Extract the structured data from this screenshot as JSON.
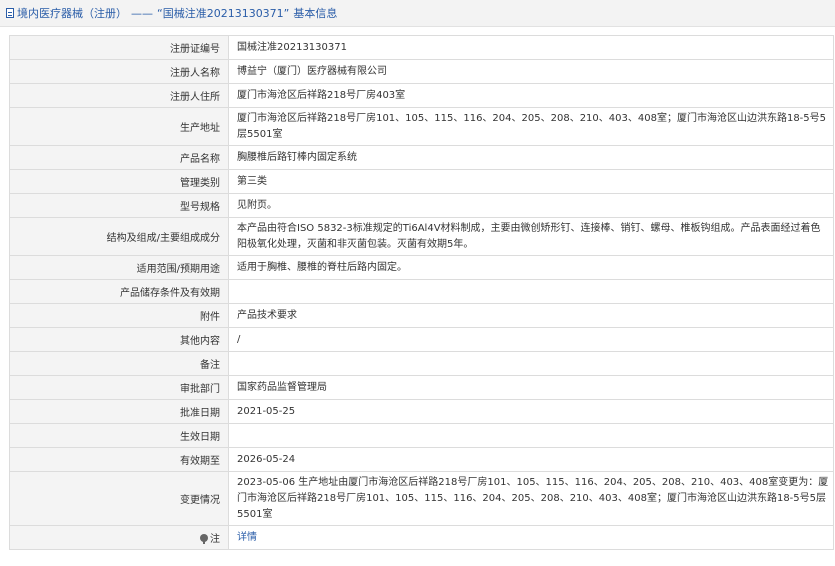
{
  "header": {
    "breadcrumb_root": "境内医疗器械（注册）",
    "separator": "——",
    "registration_title": "“国械注准20213130371”",
    "suffix": "基本信息"
  },
  "rows": [
    {
      "label": "注册证编号",
      "value": "国械注准20213130371"
    },
    {
      "label": "注册人名称",
      "value": "博益宁（厦门）医疗器械有限公司"
    },
    {
      "label": "注册人住所",
      "value": "厦门市海沧区后祥路218号厂房403室"
    },
    {
      "label": "生产地址",
      "value": "厦门市海沧区后祥路218号厂房101、105、115、116、204、205、208、210、403、408室；厦门市海沧区山边洪东路18-5号5层5501室"
    },
    {
      "label": "产品名称",
      "value": "胸腰椎后路钉棒内固定系统"
    },
    {
      "label": "管理类别",
      "value": "第三类"
    },
    {
      "label": "型号规格",
      "value": "见附页。"
    },
    {
      "label": "结构及组成/主要组成成分",
      "value": "本产品由符合ISO 5832-3标准规定的Ti6Al4V材料制成，主要由微创矫形钉、连接棒、销钉、螺母、椎板钩组成。产品表面经过着色阳极氧化处理，灭菌和非灭菌包装。灭菌有效期5年。"
    },
    {
      "label": "适用范围/预期用途",
      "value": "适用于胸椎、腰椎的脊柱后路内固定。"
    },
    {
      "label": "产品储存条件及有效期",
      "value": ""
    },
    {
      "label": "附件",
      "value": "产品技术要求"
    },
    {
      "label": "其他内容",
      "value": "/"
    },
    {
      "label": "备注",
      "value": ""
    },
    {
      "label": "审批部门",
      "value": "国家药品监督管理局"
    },
    {
      "label": "批准日期",
      "value": "2021-05-25"
    },
    {
      "label": "生效日期",
      "value": ""
    },
    {
      "label": "有效期至",
      "value": "2026-05-24"
    },
    {
      "label": "变更情况",
      "value": "2023-05-06 生产地址由厦门市海沧区后祥路218号厂房101、105、115、116、204、205、208、210、403、408室变更为：厦门市海沧区后祥路218号厂房101、105、115、116、204、205、208、210、403、408室；厦门市海沧区山边洪东路18-5号5层5501室"
    },
    {
      "label": "注",
      "value": "详情"
    }
  ]
}
